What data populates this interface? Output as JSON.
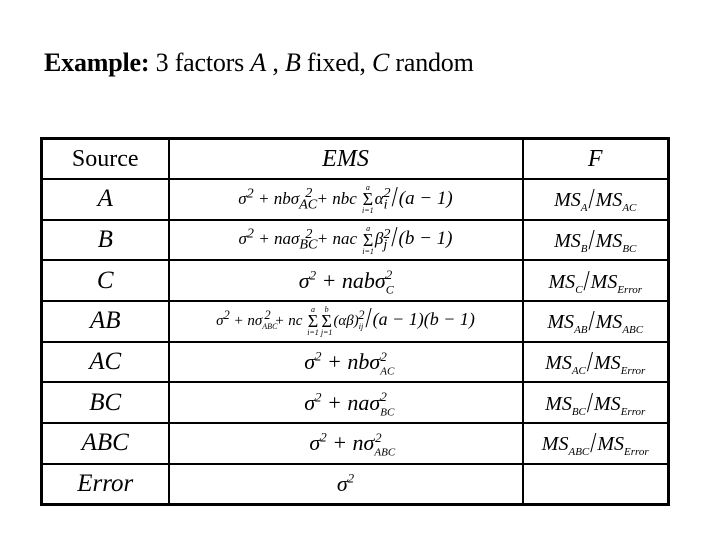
{
  "title": {
    "bold_label": "Example:",
    "text_1": " 3 factors ",
    "factor_a": "A",
    "text_2": " , ",
    "factor_b": "B",
    "text_3": " fixed, ",
    "factor_c": "C",
    "text_4": " random"
  },
  "table": {
    "headers": {
      "source": "Source",
      "ems": "EMS",
      "f": "F"
    },
    "rows": [
      {
        "source": "A",
        "ems": {
          "prefix": "σ",
          "sq": "2",
          "t1": " + nbσ",
          "sub1": "AC",
          "t2": " + nbc",
          "sum1_top": "a",
          "sum1_bot": "i=1",
          "sum_symbol": "Σ",
          "term": "α",
          "term_sub": "i",
          "term_sq": "2",
          "slash": "/",
          "denom": "(a − 1)"
        },
        "f": {
          "num": "MS",
          "num_sub": "A",
          "slash": "/",
          "den": "MS",
          "den_sub": "AC"
        }
      },
      {
        "source": "B",
        "ems": {
          "prefix": "σ",
          "sq": "2",
          "t1": " + naσ",
          "sub1": "BC",
          "t2": " + nac",
          "sum1_top": "a",
          "sum1_bot": "i=1",
          "sum_symbol": "Σ",
          "term": "β",
          "term_sub": "j",
          "term_sq": "2",
          "slash": "/",
          "denom": "(b − 1)"
        },
        "f": {
          "num": "MS",
          "num_sub": "B",
          "slash": "/",
          "den": "MS",
          "den_sub": "BC"
        }
      },
      {
        "source": "C",
        "ems": {
          "prefix": "σ",
          "sq": "2",
          "t1": " + nabσ",
          "sub1": "C"
        },
        "f": {
          "num": "MS",
          "num_sub": "C",
          "slash": "/",
          "den": "MS",
          "den_sub": "Error"
        }
      },
      {
        "source": "AB",
        "ems": {
          "prefix": "σ",
          "sq": "2",
          "t1": " + nσ",
          "sub1": "ABC",
          "t2": " + nc",
          "sum1_top": "a",
          "sum1_bot": "i=1",
          "sum2_top": "b",
          "sum2_bot": "j=1",
          "sum_symbol": "Σ",
          "term": "(αβ)",
          "term_sub": "ij",
          "term_sq": "2",
          "slash": "/",
          "denom": "(a − 1)(b − 1)"
        },
        "f": {
          "num": "MS",
          "num_sub": "AB",
          "slash": "/",
          "den": "MS",
          "den_sub": "ABC"
        }
      },
      {
        "source": "AC",
        "ems": {
          "prefix": "σ",
          "sq": "2",
          "t1": " + nbσ",
          "sub1": "AC"
        },
        "f": {
          "num": "MS",
          "num_sub": "AC",
          "slash": "/",
          "den": "MS",
          "den_sub": "Error"
        }
      },
      {
        "source": "BC",
        "ems": {
          "prefix": "σ",
          "sq": "2",
          "t1": " + naσ",
          "sub1": "BC"
        },
        "f": {
          "num": "MS",
          "num_sub": "BC",
          "slash": "/",
          "den": "MS",
          "den_sub": "Error"
        }
      },
      {
        "source": "ABC",
        "ems": {
          "prefix": "σ",
          "sq": "2",
          "t1": " + nσ",
          "sub1": "ABC"
        },
        "f": {
          "num": "MS",
          "num_sub": "ABC",
          "slash": "/",
          "den": "MS",
          "den_sub": "Error"
        }
      },
      {
        "source": "Error",
        "ems": {
          "prefix": "σ",
          "sq": "2"
        },
        "f": null
      }
    ]
  }
}
